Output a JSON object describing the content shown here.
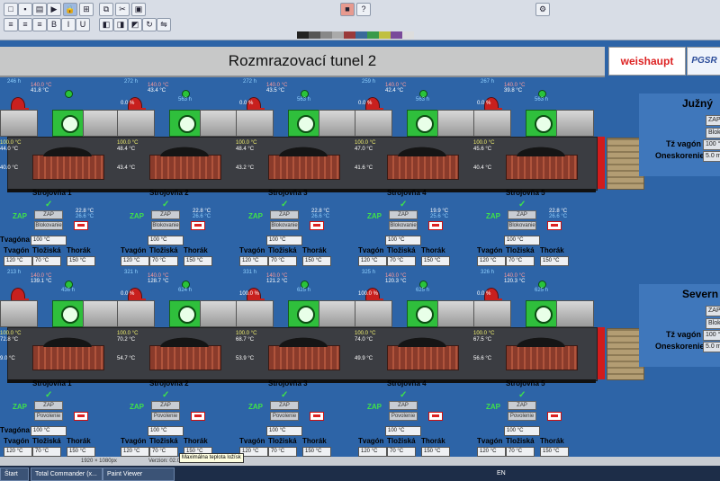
{
  "window": {
    "title": "Rozmrazovací tunel 2"
  },
  "logos": {
    "primary": "weishaupt",
    "secondary": "PGSR"
  },
  "colors": {
    "background": "#2d64a7",
    "run_green": "#3fe24a",
    "alarm_red": "#c8201e",
    "header_gray": "#c7c8c8"
  },
  "tunnels": [
    {
      "side_title": "Južný",
      "side_fields": {
        "tz_label": "Tž vagón",
        "tz_value": "100 °C",
        "delay_label": "Oneskorenie",
        "delay_value": "5.0 mi"
      },
      "stations": [
        {
          "name": "Strojovňa 1",
          "hours": "246 h",
          "temp_red": "140.0 °C",
          "temp": "41.8 °C",
          "pct": "",
          "hours2": "",
          "status": "ZAP",
          "t_set": "22.8 °C",
          "t_sub": "26.6 °C",
          "tvagona": "100 °C",
          "vals": [
            "120 °C",
            "70 °C",
            "150 °C"
          ],
          "in_temp": "100.0 °C",
          "in_t2": "44.0 °C",
          "out_temp": "40.0 °C"
        },
        {
          "name": "Strojovňa 2",
          "hours": "272 h",
          "temp_red": "140.0 °C",
          "temp": "43.4 °C",
          "pct": "0.0 %",
          "hours2": "563 h",
          "status": "ZAP",
          "t_set": "22.8 °C",
          "t_sub": "26.6 °C",
          "tvagona": "100 °C",
          "vals": [
            "120 °C",
            "70 °C",
            "150 °C"
          ],
          "in_temp": "100.0 °C",
          "in_t2": "48.4 °C",
          "out_temp": "43.4 °C"
        },
        {
          "name": "Strojovňa 3",
          "hours": "272 h",
          "temp_red": "140.0 °C",
          "temp": "43.5 °C",
          "pct": "0.0 %",
          "hours2": "563 h",
          "status": "ZAP",
          "t_set": "22.8 °C",
          "t_sub": "26.6 °C",
          "tvagona": "100 °C",
          "vals": [
            "120 °C",
            "70 °C",
            "150 °C"
          ],
          "in_temp": "100.0 °C",
          "in_t2": "48.4 °C",
          "out_temp": "43.2 °C"
        },
        {
          "name": "Strojovňa 4",
          "hours": "259 h",
          "temp_red": "140.0 °C",
          "temp": "42.4 °C",
          "pct": "0.0 %",
          "hours2": "563 h",
          "status": "ZAP",
          "t_set": "19.9 °C",
          "t_sub": "25.6 °C",
          "tvagona": "100 °C",
          "vals": [
            "120 °C",
            "70 °C",
            "150 °C"
          ],
          "in_temp": "100.0 °C",
          "in_t2": "47.0 °C",
          "out_temp": "41.6 °C"
        },
        {
          "name": "Strojovňa 5",
          "hours": "267 h",
          "temp_red": "140.0 °C",
          "temp": "39.8 °C",
          "pct": "0.0 %",
          "hours2": "563 h",
          "status": "ZAP",
          "t_set": "22.8 °C",
          "t_sub": "26.6 °C",
          "tvagona": "100 °C",
          "vals": [
            "120 °C",
            "70 °C",
            "150 °C"
          ],
          "in_temp": "100.0 °C",
          "in_t2": "45.6 °C",
          "out_temp": "40.4 °C"
        }
      ],
      "row_labels": {
        "tvagona": "Tvagóna",
        "tvagon": "Tvagón",
        "tloziska": "Tložiská",
        "thorak": "Thorák"
      }
    },
    {
      "side_title": "Severn",
      "side_fields": {
        "tz_label": "Tž vagón",
        "tz_value": "100 °C",
        "delay_label": "Oneskorenie",
        "delay_value": "5.0 mi"
      },
      "stations": [
        {
          "name": "Strojovňa 1",
          "hours": "213 h",
          "temp_red": "140.0 °C",
          "temp": "139.1 °C",
          "pct": "",
          "hours2": "436 h",
          "status": "ZAP",
          "t_set": "",
          "t_sub": "",
          "tvagona": "100 °C",
          "vals": [
            "120 °C",
            "70 °C",
            "150 °C"
          ],
          "in_temp": "100.0 °C",
          "in_t2": "72.8 °C",
          "out_temp": "9.0 °C"
        },
        {
          "name": "Strojovňa 2",
          "hours": "321 h",
          "temp_red": "140.0 °C",
          "temp": "128.7 °C",
          "pct": "0.0 %",
          "hours2": "624 h",
          "status": "ZAP",
          "t_set": "",
          "t_sub": "",
          "tvagona": "100 °C",
          "vals": [
            "120 °C",
            "70 °C",
            "150 °C"
          ],
          "in_temp": "100.0 °C",
          "in_t2": "70.2 °C",
          "out_temp": "54.7 °C"
        },
        {
          "name": "Strojovňa 3",
          "hours": "331 h",
          "temp_red": "140.0 °C",
          "temp": "121.2 °C",
          "pct": "100.0 %",
          "hours2": "625 h",
          "status": "ZAP",
          "t_set": "",
          "t_sub": "",
          "tvagona": "100 °C",
          "vals": [
            "120 °C",
            "70 °C",
            "150 °C"
          ],
          "in_temp": "100.0 °C",
          "in_t2": "68.7 °C",
          "out_temp": "53.9 °C"
        },
        {
          "name": "Strojovňa 4",
          "hours": "325 h",
          "temp_red": "140.0 °C",
          "temp": "120.3 °C",
          "pct": "100.0 %",
          "hours2": "625 h",
          "status": "ZAP",
          "t_set": "",
          "t_sub": "",
          "tvagona": "100 °C",
          "vals": [
            "120 °C",
            "70 °C",
            "150 °C"
          ],
          "in_temp": "100.0 °C",
          "in_t2": "74.0 °C",
          "out_temp": "49.9 °C"
        },
        {
          "name": "Strojovňa 5",
          "hours": "326 h",
          "temp_red": "140.0 °C",
          "temp": "120.3 °C",
          "pct": "0.0 %",
          "hours2": "625 h",
          "status": "ZAP",
          "t_set": "",
          "t_sub": "",
          "tvagona": "100 °C",
          "vals": [
            "120 °C",
            "70 °C",
            "150 °C"
          ],
          "in_temp": "100.0 °C",
          "in_t2": "67.5 °C",
          "out_temp": "56.6 °C"
        }
      ],
      "row_labels": {
        "tvagona": "Tvagóna",
        "tvagon": "Tvagón",
        "tloziska": "Tložiská",
        "thorak": "Thorák"
      }
    }
  ],
  "buttons": {
    "zap": "ZAP",
    "blokovanie": "Blokovanie",
    "povolenie": "Povolenie"
  },
  "tooltip": "Maximálna teplota ložísk",
  "status_bar": {
    "resolution": "1920 × 1080px",
    "version": "Verzion: 02.0"
  },
  "taskbar": {
    "start": "Štart",
    "task1": "Total Commander (x...",
    "task2": "Paint Viewer",
    "lang": "EN"
  }
}
